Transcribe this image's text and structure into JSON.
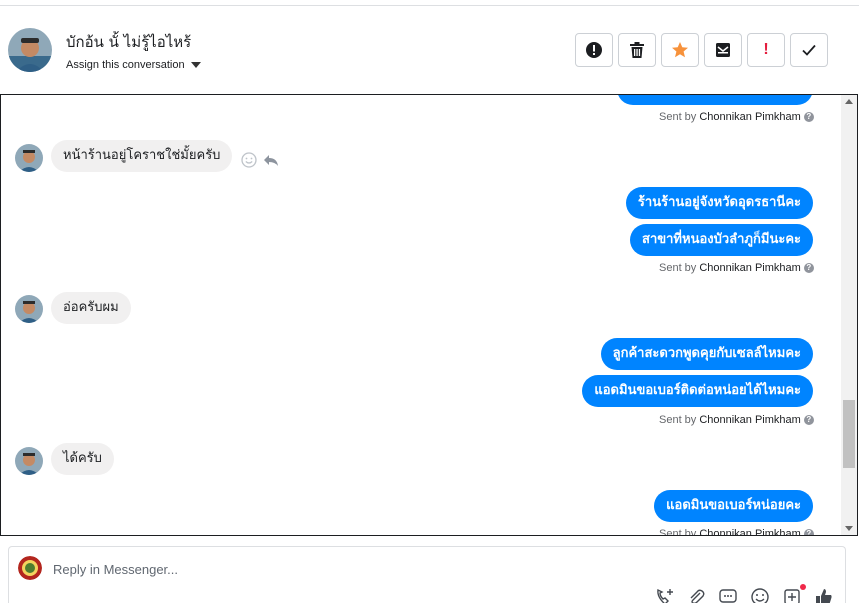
{
  "header": {
    "contact_name": "บักอ้น นั้ ไม่รู้ไอไหร้",
    "assign_label": "Assign this conversation",
    "actions": [
      {
        "name": "mark-spam-button",
        "icon": "alert-circle-icon"
      },
      {
        "name": "delete-button",
        "icon": "trash-icon"
      },
      {
        "name": "star-button",
        "icon": "star-icon"
      },
      {
        "name": "mark-unread-button",
        "icon": "envelope-icon"
      },
      {
        "name": "follow-up-button",
        "icon": "exclamation-icon"
      },
      {
        "name": "mark-done-button",
        "icon": "check-icon"
      }
    ]
  },
  "thread": {
    "sent_by_prefix": "Sent by",
    "agent_name": "Chonnikan Pimkham",
    "messages": [
      {
        "dir": "out",
        "text": "ร้านร้านอยู่จังหวัดอุดรธานีคะ"
      },
      {
        "dir": "out",
        "text": "สาขาที่หนองบัวลำภูก็มีนะคะ"
      },
      {
        "dir": "in",
        "text": "หน้าร้านอยู่โคราชใช่มั้ยครับ"
      },
      {
        "dir": "in",
        "text": "อ่อครับผม"
      },
      {
        "dir": "out",
        "text": "ลูกค้าสะดวกพูดคุยกับเซลล์ไหมคะ"
      },
      {
        "dir": "out",
        "text": "แอดมินขอเบอร์ติดต่อหน่อยได้ไหมคะ"
      },
      {
        "dir": "in",
        "text": "ได้ครับ"
      },
      {
        "dir": "out",
        "text": "แอดมินขอเบอร์หน่อยคะ"
      }
    ]
  },
  "composer": {
    "placeholder": "Reply in Messenger..."
  },
  "colors": {
    "outgoing_bubble": "#0084ff",
    "incoming_bubble": "#f1f0f0",
    "star": "#f7923b",
    "alert": "#e41e3f"
  }
}
